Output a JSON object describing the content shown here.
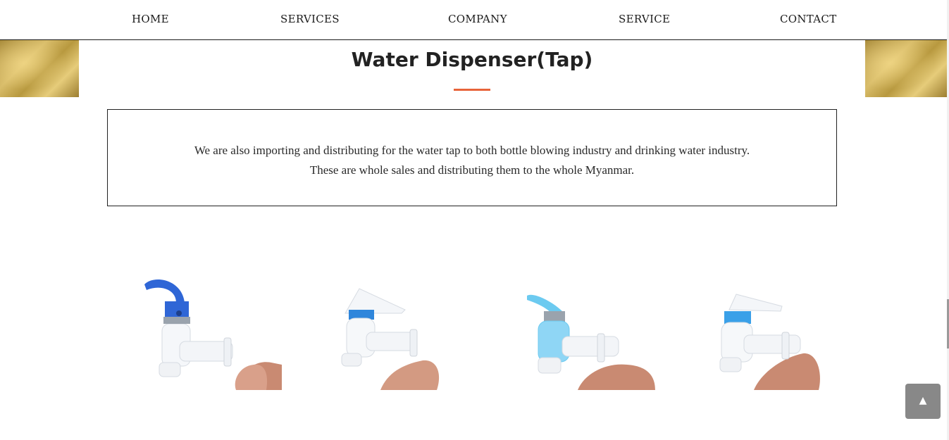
{
  "nav": {
    "items": [
      {
        "label": "HOME"
      },
      {
        "label": "SERVICES"
      },
      {
        "label": "COMPANY"
      },
      {
        "label": "SERVICE"
      },
      {
        "label": "CONTACT"
      }
    ]
  },
  "section": {
    "title": "Water Dispenser(Tap)",
    "accent_color": "#e8643a",
    "description": {
      "line1": "We are also importing and distributing for the water tap to both bottle blowing industry and drinking water industry.",
      "line2": "These are whole sales and distributing them to the whole Myanmar."
    }
  },
  "products": [
    {
      "icon": "water-tap-image",
      "cap_color": "#2f66d6"
    },
    {
      "icon": "water-tap-image",
      "cap_color": "#2f86db"
    },
    {
      "icon": "water-tap-image",
      "cap_color": "#6ccaf0"
    },
    {
      "icon": "water-tap-image",
      "cap_color": "#3aa0e8"
    }
  ],
  "scroll_top": {
    "icon": "chevron-up-icon",
    "glyph": "▲"
  }
}
